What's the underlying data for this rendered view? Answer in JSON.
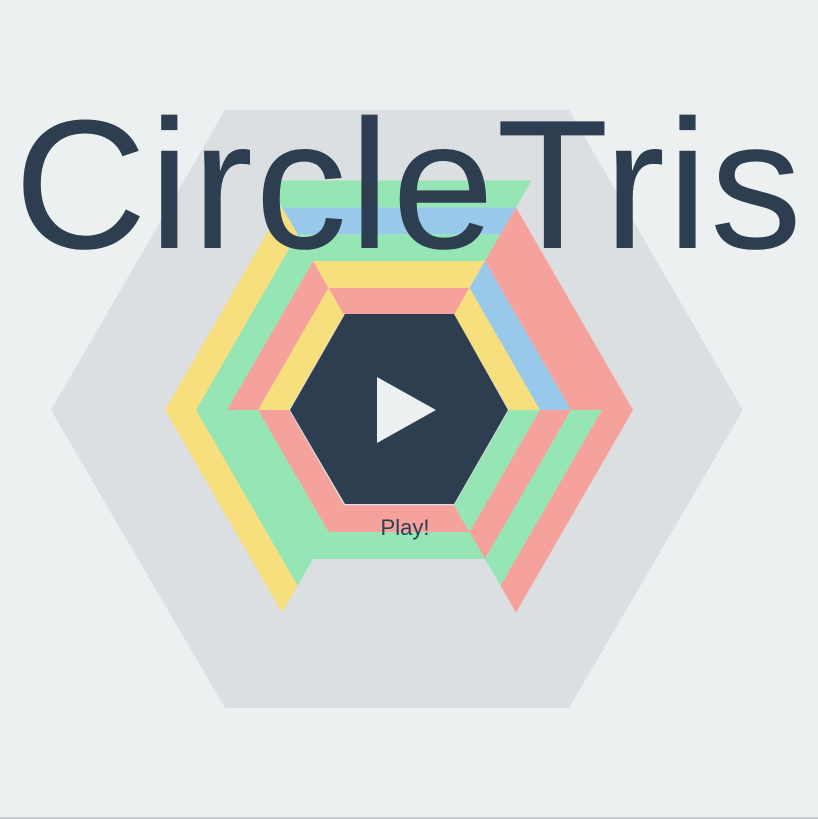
{
  "game": {
    "title": "CircleTris",
    "play_label": "Play!"
  },
  "play_button": {
    "icon": "play-icon"
  },
  "colors": {
    "background": "#ecf0f1",
    "outer_hex": "#dcdfe1",
    "dark": "#2c3e50",
    "play_icon": "#ecf0f1",
    "yellow": "#f8df7e",
    "green": "#95e5b5",
    "red": "#f4a29b",
    "blue": "#98c9ea"
  }
}
